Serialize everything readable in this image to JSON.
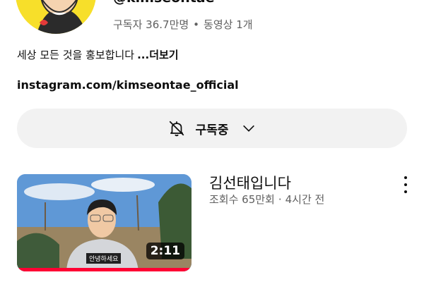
{
  "channel": {
    "handle": "@kimseontae",
    "subscribers": "구독자 36.7만명",
    "separator": "•",
    "videos": "동영상 1개",
    "description": "세상 모든 것을 홍보합니다",
    "more_label": "...더보기",
    "link": "instagram.com/kimseontae_official"
  },
  "subscribe_button": {
    "label": "구독중",
    "bell_icon": "bell-off-icon",
    "chevron_icon": "chevron-down-icon"
  },
  "video": {
    "title": "김선태입니다",
    "views": "조회수 65만회",
    "separator": "·",
    "age": "4시간 전",
    "duration": "2:11",
    "caption": "안녕하세요",
    "watch_progress": 1.0,
    "menu_icon": "more-vert-icon"
  },
  "colors": {
    "progress": "#ff0033",
    "avatar_bg": "#f7df2a",
    "button_bg": "#f2f2f2",
    "secondary_text": "#606060"
  }
}
